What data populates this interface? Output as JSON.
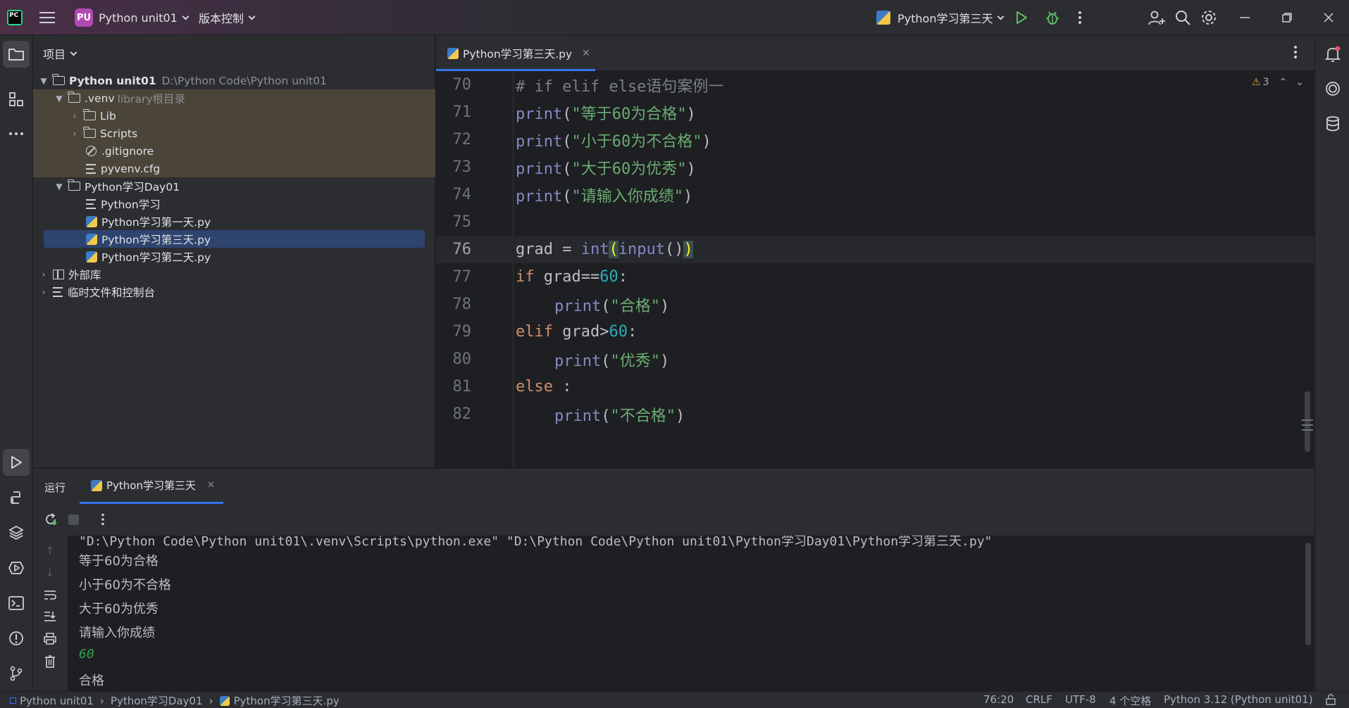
{
  "titlebar": {
    "project_badge": "PU",
    "project_name": "Python unit01",
    "vcs_label": "版本控制",
    "run_config": "Python学习第三天"
  },
  "project_panel": {
    "title": "项目",
    "tree": [
      {
        "label": "Python unit01",
        "path": "D:\\Python Code\\Python unit01"
      },
      {
        "label": ".venv",
        "hint": "library根目录"
      },
      {
        "label": "Lib"
      },
      {
        "label": "Scripts"
      },
      {
        "label": ".gitignore"
      },
      {
        "label": "pyvenv.cfg"
      },
      {
        "label": "Python学习Day01"
      },
      {
        "label": "Python学习"
      },
      {
        "label": "Python学习第一天.py"
      },
      {
        "label": "Python学习第三天.py"
      },
      {
        "label": "Python学习第二天.py"
      },
      {
        "label": "外部库"
      },
      {
        "label": "临时文件和控制台"
      }
    ]
  },
  "editor": {
    "tab_label": "Python学习第三天.py",
    "warnings_count": "3",
    "line_numbers": [
      "70",
      "71",
      "72",
      "73",
      "74",
      "75",
      "76",
      "77",
      "78",
      "79",
      "80",
      "81",
      "82"
    ],
    "current_line": "76",
    "code": {
      "l70": "# if elif else语句案例一",
      "l71_fn": "print",
      "l71_str": "\"等于60为合格\"",
      "l72_fn": "print",
      "l72_str": "\"小于60为不合格\"",
      "l73_fn": "print",
      "l73_str": "\"大于60为优秀\"",
      "l74_fn": "print",
      "l74_str": "\"请输入你成绩\"",
      "l76_a": "grad = ",
      "l76_int": "int",
      "l76_open": "(",
      "l76_input": "input",
      "l76_mid": "()",
      "l76_close": ")",
      "l77_kw": "if",
      "l77_a": " grad==",
      "l77_num": "60",
      "l77_b": ":",
      "l78_fn": "print",
      "l78_str": "\"合格\"",
      "l79_kw": "elif",
      "l79_a": " grad>",
      "l79_num": "60",
      "l79_b": ":",
      "l80_fn": "print",
      "l80_str": "\"优秀\"",
      "l81_kw": "else",
      "l81_b": " :",
      "l82_fn": "print",
      "l82_str": "\"不合格\""
    }
  },
  "run_panel": {
    "title": "运行",
    "tab_label": "Python学习第三天",
    "console": [
      "\"D:\\Python Code\\Python unit01\\.venv\\Scripts\\python.exe\" \"D:\\Python Code\\Python unit01\\Python学习Day01\\Python学习第三天.py\"",
      "等于60为合格",
      "小于60为不合格",
      "大于60为优秀",
      "请输入你成绩",
      "60",
      "合格"
    ]
  },
  "statusbar": {
    "breadcrumb": [
      "Python unit01",
      "Python学习Day01",
      "Python学习第三天.py"
    ],
    "position": "76:20",
    "line_sep": "CRLF",
    "encoding": "UTF-8",
    "indent": "4 个空格",
    "interpreter": "Python 3.12 (Python unit01)"
  }
}
